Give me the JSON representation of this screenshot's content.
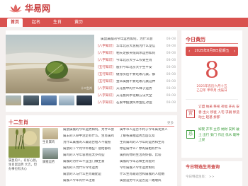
{
  "brand": {
    "name": "华易网",
    "color": "#c83c3c",
    "accent": "#d9524f"
  },
  "nav": [
    {
      "label": "首页",
      "active": true
    },
    {
      "label": "起名",
      "active": false
    },
    {
      "label": "生肖",
      "active": false
    },
    {
      "label": "黄历",
      "active": false
    }
  ],
  "hero": {
    "caption": "十二生肖",
    "thumbnails": [
      "thumb-1",
      "thumb-2",
      "thumb-3",
      "thumb-4",
      "thumb-5"
    ]
  },
  "news": [
    {
      "tag": "",
      "title": "属鼠属猴的今年运势如何，为什么会",
      "date": "08-08"
    },
    {
      "tag": "[八字知识]",
      "title": "华年北京大总统为什么宠信",
      "date": "08-08"
    },
    {
      "tag": "[八字知识]",
      "title": "相天足部夹缝风水运势如何",
      "date": "08-08"
    },
    {
      "tag": "[八字知识]",
      "title": "今年北京大学工作受生肖",
      "date": "08-08"
    },
    {
      "tag": "[五行知识]",
      "title": "股价今年北京大学生平安",
      "date": "08-08"
    },
    {
      "tag": "[五行知识]",
      "title": "健身房后不要吃哪几类，都",
      "date": "08-08"
    },
    {
      "tag": "[五行知识]",
      "title": "金华属猪不要吃哪几类这种",
      "date": "08-08"
    },
    {
      "tag": "[八字知识]",
      "title": "天花板中的什么样子运势",
      "date": "08-08"
    },
    {
      "tag": "[八字知识]",
      "title": "天花板风水化解方法大全",
      "date": "08-08"
    },
    {
      "tag": "[八字知识]",
      "title": "在家中摆放风水鱼缸对运",
      "date": "08-08"
    }
  ],
  "calendar": {
    "title": "今日黄历",
    "date_line": "2025年8月8日星期五",
    "day": "8",
    "lunar_line1": "2025年农历六月十五",
    "lunar_line2": "乙巳年 甲申月 戊辰日",
    "yi_label": "宜",
    "yi_items": "订盟 纳采 祭祀 祈福 开光 安香 出火 移徙 入宅 求嗣 修造 动土 起基 拆卸",
    "ji_label": "忌",
    "ji_items": "嫁娶 开市 立券 纳财 安葬 破土 出行 安门 作灶 伐木 栽种 上梁"
  },
  "zodiac": {
    "title": "十二生肖",
    "more": "更多",
    "big_caption": "属鼠的人，有好心肠，生肖鼠运势 大吉，但办事也有决心",
    "small_caption_1": "生肖属鸡",
    "small_caption_2": "属猪运势",
    "mid_list": [
      "属鼠属猴的今年运势如何，为什么会",
      "属羊的人命中注定有什么，生肖属鸡",
      "为什么属猪的人最适合给人不能惹",
      "属鼠的下个月今年哪些？总结都有",
      "属鸡的人今年容易犯太岁有些",
      "属猴的为什么不宜出门做生意",
      "属狗的人为什么今年运势",
      "属鼠的人与什么生肖最配是",
      "属猴人今年有什么注意"
    ],
    "right_list": [
      "属牛带人是否不利于今年属龙女人",
      "了解各属相运势吉凶以及",
      "生肖属鸡的人今年的运势和生肖",
      "你是属什么？你的属相有什么",
      "属狗的你的生活的好都，比较",
      "属猴的今年怎样生肖配对",
      "今年属猴人今年运势如何",
      "什么生肖最适合和属猴的人结婚",
      "属鼠运势今天是否是一路顺风"
    ]
  },
  "query": {
    "title": "今日特选生肖查询",
    "placeholder": "今日特选生肖：  >>"
  }
}
